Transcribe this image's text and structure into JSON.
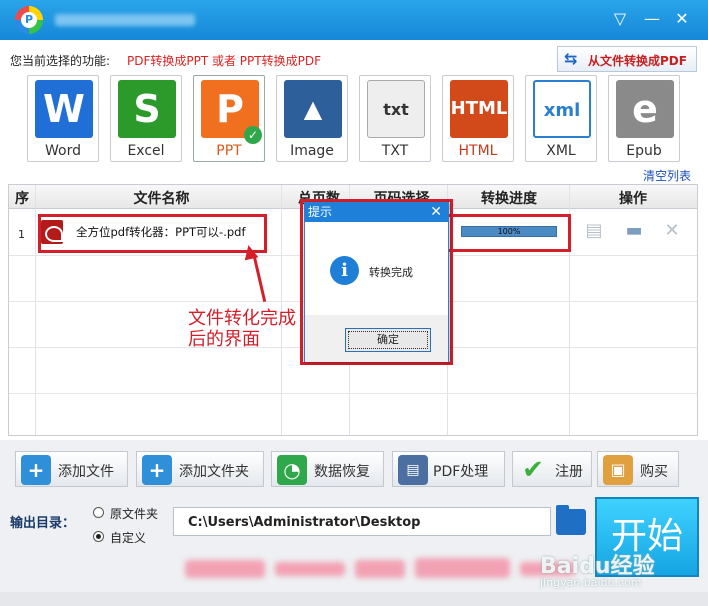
{
  "window": {
    "title": ""
  },
  "toolbar": {
    "function_label": "您当前选择的功能:",
    "function_value": "PDF转换成PPT 或者 PPT转换成PDF",
    "from_file_button": "从文件转换成PDF"
  },
  "formats": [
    {
      "label": "Word",
      "icon": "W",
      "color": "#1f6fd6"
    },
    {
      "label": "Excel",
      "icon": "S",
      "color": "#2b9a2b"
    },
    {
      "label": "PPT",
      "icon": "P",
      "color": "#f07020",
      "selected": true
    },
    {
      "label": "Image",
      "icon": "image-icon",
      "color": "#2d5f9a"
    },
    {
      "label": "TXT",
      "icon": "txt",
      "color": "#888888"
    },
    {
      "label": "HTML",
      "icon": "HTML",
      "color": "#d24a1a"
    },
    {
      "label": "XML",
      "icon": "xml",
      "color": "#2a7fd0"
    },
    {
      "label": "Epub",
      "icon": "e",
      "color": "#8a8a8a"
    }
  ],
  "list": {
    "clear_label": "清空列表",
    "headers": [
      "序",
      "文件名称",
      "总页数",
      "页码选择",
      "转换进度",
      "操作"
    ],
    "rows": [
      {
        "index": "1",
        "filename": "全方位pdf转化器：PPT可以-.pdf",
        "progress_label": "100%",
        "progress": 1.0
      }
    ]
  },
  "annotation": {
    "line1": "文件转化完成",
    "line2": "后的界面"
  },
  "dialog": {
    "title": "提示",
    "message": "转换完成",
    "ok": "确定"
  },
  "actions": {
    "add_file": "添加文件",
    "add_folder": "添加文件夹",
    "recover": "数据恢复",
    "pdf_process": "PDF处理",
    "register": "注册",
    "buy": "购买"
  },
  "output": {
    "label": "输出目录：",
    "option_source": "原文件夹",
    "option_custom": "自定义",
    "selected": "custom",
    "path": "C:\\Users\\Administrator\\Desktop"
  },
  "start_label": "开始",
  "watermark": {
    "brand": "Baidu经验",
    "url": "jingyan.baidu.com"
  },
  "colors": {
    "titlebar": "#1e90e0",
    "accent_red": "#d41f2a",
    "start": "#2bbcf0"
  }
}
